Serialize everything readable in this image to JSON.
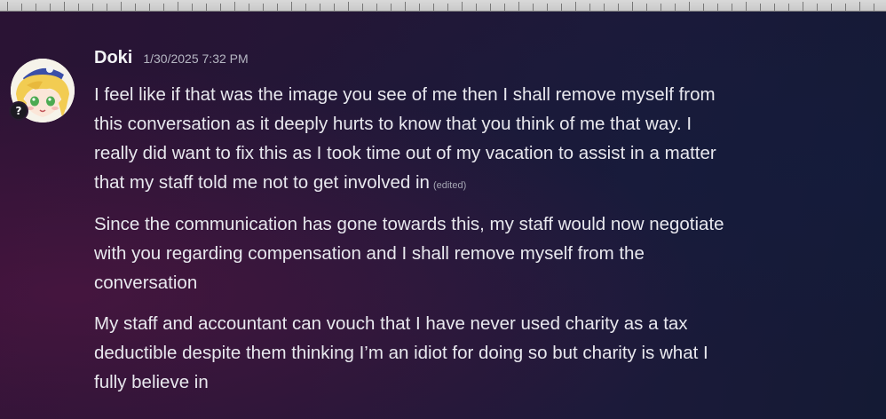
{
  "message": {
    "author": "Doki",
    "timestamp": "1/30/2025 7:32 PM",
    "avatar": "anime-avatar",
    "edited_label": "(edited)",
    "paragraphs": [
      {
        "lines": [
          "I feel like if that was the image you see of me then I shall remove myself from",
          "this conversation as it deeply hurts to know that you think of me that way. I",
          "really did want to fix this as I took time out of my vacation to assist in a matter",
          "that my staff told me not to get involved in"
        ],
        "edited": true
      },
      {
        "lines": [
          "Since the communication has gone towards this, my staff would now negotiate",
          "with you regarding compensation and I shall  remove myself from the",
          "conversation"
        ],
        "edited": false
      },
      {
        "lines": [
          "My staff and accountant can vouch that I have never used charity as a tax",
          "deductible despite them thinking I’m an idiot for doing so but charity is what I",
          "fully believe in"
        ],
        "edited": false
      }
    ]
  },
  "colors": {
    "username": "#f2f3f5",
    "timestamp": "#b6b7c3",
    "body_text": "#e8e8ee",
    "background_left": "#2a1334",
    "background_right": "#141a34"
  }
}
